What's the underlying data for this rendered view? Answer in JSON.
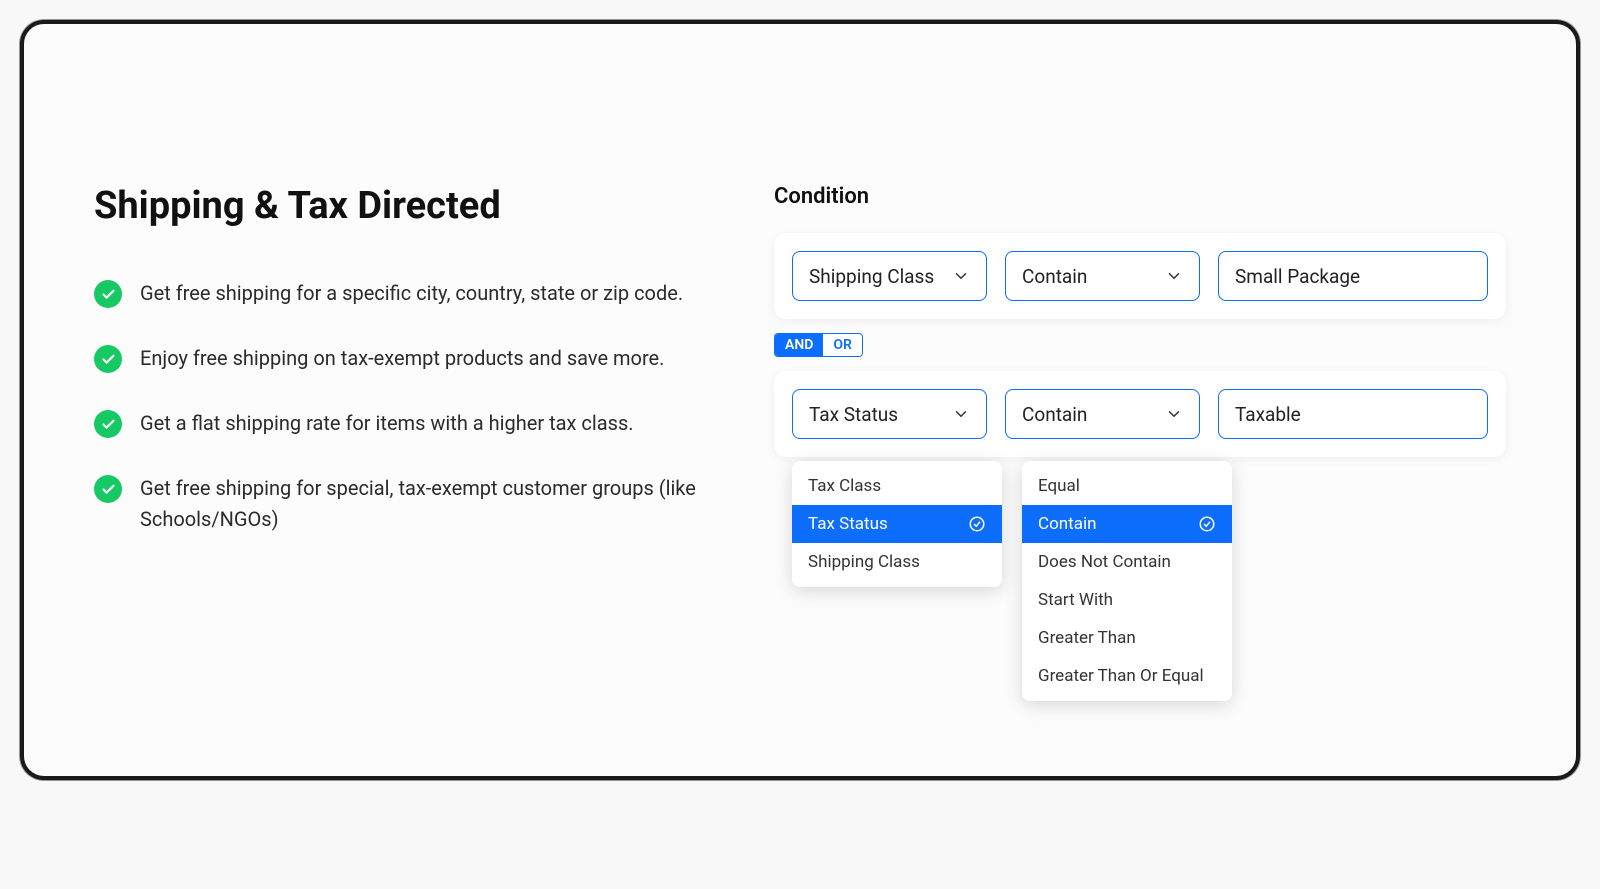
{
  "title": "Shipping & Tax Directed",
  "bullets": [
    "Get free shipping for a specific city, country, state or zip code.",
    "Enjoy free shipping on tax-exempt products and save more.",
    "Get a flat shipping rate for items with a higher tax class.",
    "Get free shipping for special, tax-exempt customer groups (like Schools/NGOs)"
  ],
  "condition_label": "Condition",
  "row1": {
    "field": "Shipping Class",
    "operator": "Contain",
    "value": "Small Package"
  },
  "logic": {
    "and": "AND",
    "or": "OR"
  },
  "row2": {
    "field": "Tax Status",
    "operator": "Contain",
    "value": "Taxable"
  },
  "field_dropdown": {
    "options": [
      "Tax Class",
      "Tax Status",
      "Shipping Class"
    ],
    "selected": "Tax Status"
  },
  "operator_dropdown": {
    "options": [
      "Equal",
      "Contain",
      "Does Not Contain",
      "Start With",
      "Greater Than",
      "Greater Than Or Equal"
    ],
    "selected": "Contain"
  }
}
